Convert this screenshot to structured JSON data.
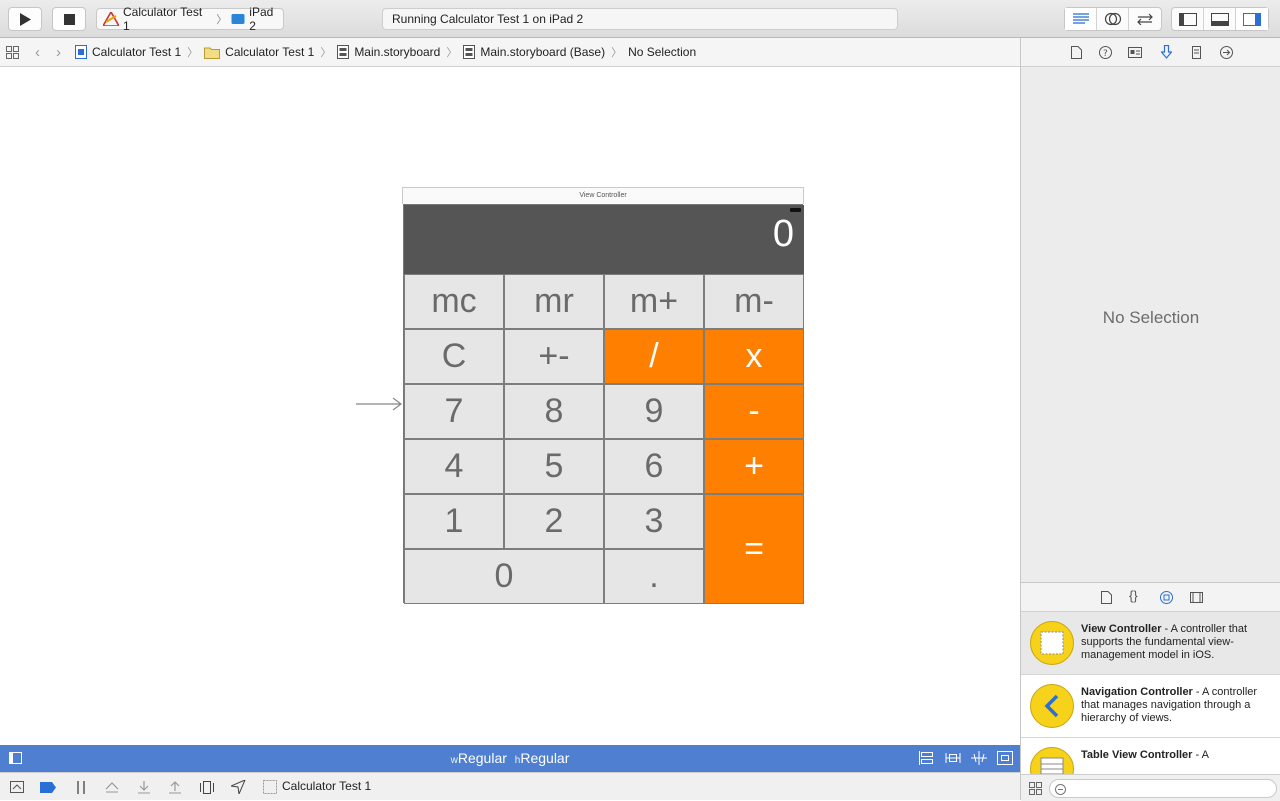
{
  "toolbar": {
    "run_icon": "play-icon",
    "stop_icon": "stop-icon",
    "scheme": {
      "target": "Calculator Test 1",
      "device": "iPad 2"
    },
    "activity": "Running Calculator Test 1 on iPad 2"
  },
  "jumpbar": {
    "crumbs": [
      {
        "label": "Calculator Test 1",
        "icon": "project-icon"
      },
      {
        "label": "Calculator Test 1",
        "icon": "folder-icon"
      },
      {
        "label": "Main.storyboard",
        "icon": "storyboard-icon"
      },
      {
        "label": "Main.storyboard (Base)",
        "icon": "storyboard-icon"
      },
      {
        "label": "No Selection",
        "icon": ""
      }
    ]
  },
  "canvas": {
    "scene_title": "View Controller",
    "display_value": "0",
    "keys": {
      "mc": "mc",
      "mr": "mr",
      "mplus": "m+",
      "mminus": "m-",
      "clear": "C",
      "sign": "+-",
      "divide": "/",
      "multiply": "x",
      "seven": "7",
      "eight": "8",
      "nine": "9",
      "minus": "-",
      "four": "4",
      "five": "5",
      "six": "6",
      "plus": "+",
      "one": "1",
      "two": "2",
      "three": "3",
      "equals": "=",
      "zero": "0",
      "dot": "."
    },
    "accent_color": "#ff7f00"
  },
  "size_class": {
    "w_prefix": "w",
    "w_value": "Regular",
    "h_prefix": "h",
    "h_value": "Regular"
  },
  "debug": {
    "process": "Calculator Test 1"
  },
  "inspector": {
    "empty_text": "No Selection"
  },
  "library": {
    "items": [
      {
        "name": "View Controller",
        "desc": " - A controller that supports the fundamental view-management model in iOS."
      },
      {
        "name": "Navigation Controller",
        "desc": " - A controller that manages navigation through a hierarchy of views."
      },
      {
        "name": "Table View Controller",
        "desc": " - A"
      }
    ]
  }
}
